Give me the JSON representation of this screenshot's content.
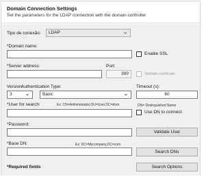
{
  "header": {
    "title": "Domain Connection Settings",
    "subtitle": "Set the parameters for the LDAP connection with the domain controller"
  },
  "connection_type": {
    "label": "Tipo de conexão:",
    "value": "LDAP"
  },
  "domain_name": {
    "label": "*Domain name:",
    "value": "",
    "enable_ssl_label": "Enable SSL",
    "enable_ssl_checked": false
  },
  "server": {
    "address_label": "*Server address:",
    "address_value": "",
    "port_label": "Port:",
    "port_value": "389",
    "validate_certificate_label": "Validate certificate",
    "validate_certificate_checked": false
  },
  "version": {
    "label": "Version:",
    "value": "3"
  },
  "auth_type": {
    "label": "Authentication Type:",
    "value": "Basic"
  },
  "timeout": {
    "label": "Timeout (s):",
    "value": "60"
  },
  "user_for_search": {
    "label": "*User for search:",
    "example": "Ex: CN=Administrator,OU=User,DC=dom",
    "value": "",
    "dn_hint": "DN= Distinguished Name",
    "use_dn_label": "Use DN to connect",
    "use_dn_checked": false
  },
  "password": {
    "label": "*Password:",
    "value": "",
    "validate_user_label": "Validate User"
  },
  "base_dn": {
    "label": "*Base DN:",
    "example": "Ex: DC=Mycompany,DC=com",
    "value": "",
    "search_dns_label": "Search DNs"
  },
  "footer": {
    "required_fields_label": "*Required fields",
    "search_options_label": "Search Options"
  },
  "icons": {
    "dropdown": "chevron-down-icon"
  },
  "colors": {
    "panel_bg": "#f0f0f0",
    "header_bg": "#ffffff",
    "button_bg": "#e1e1e1",
    "input_border": "#7a7a7a"
  }
}
